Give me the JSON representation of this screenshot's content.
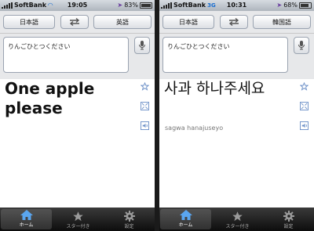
{
  "screens": [
    {
      "status": {
        "carrier": "SoftBank",
        "network": "",
        "time": "19:05",
        "battery": "83%"
      },
      "source_lang": "日本語",
      "target_lang": "英語",
      "input_text": "りんごひとつください",
      "translation": "One apple please",
      "romanization": "",
      "tabs": [
        "ホーム",
        "スター付き",
        "設定"
      ]
    },
    {
      "status": {
        "carrier": "SoftBank",
        "network": "3G",
        "time": "10:31",
        "battery": "68%"
      },
      "source_lang": "日本語",
      "target_lang": "韓国語",
      "input_text": "りんごひとつください",
      "translation": "사과 하나주세요",
      "romanization": "sagwa hanajuseyo",
      "tabs": [
        "ホーム",
        "スター付き",
        "設定"
      ]
    }
  ],
  "colors": {
    "icon_blue": "#6b8fc7",
    "tab_active_blue": "#5aa6f0"
  }
}
